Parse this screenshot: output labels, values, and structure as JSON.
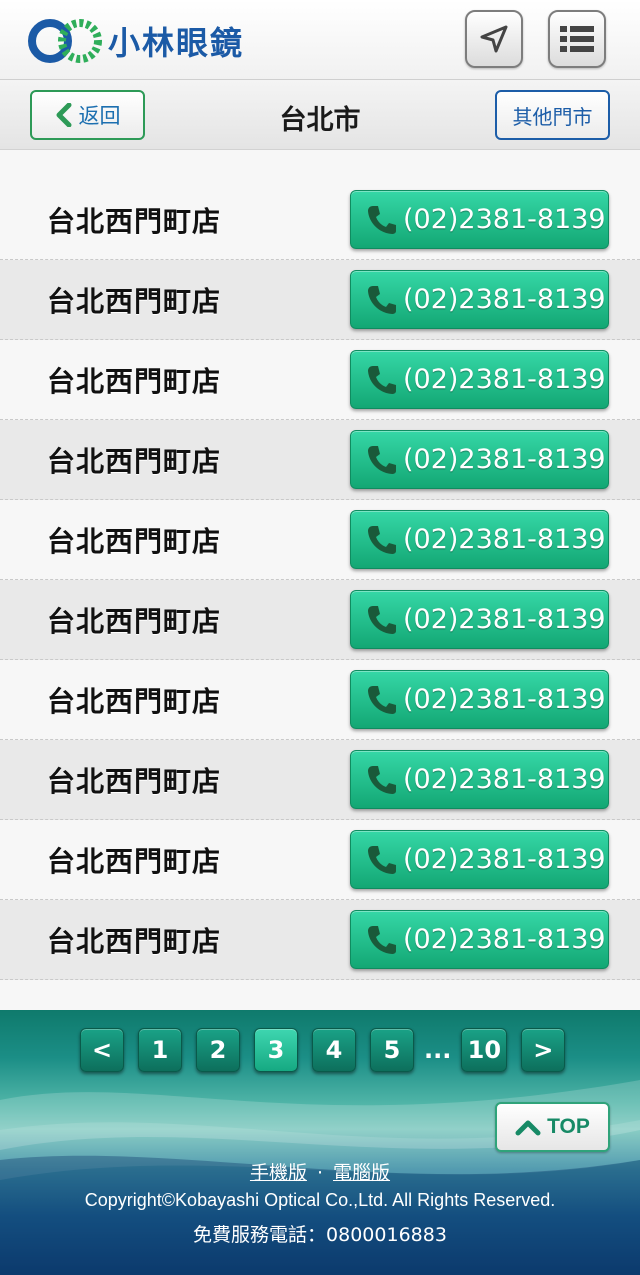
{
  "brand": {
    "name": "小林眼鏡",
    "color": "#1b5aa6"
  },
  "header": {
    "locate_icon": "navigation-arrow-icon",
    "menu_icon": "list-menu-icon"
  },
  "subbar": {
    "back_label": "返回",
    "city": "台北市",
    "other_label": "其他門市"
  },
  "stores": [
    {
      "name": "台北西門町店",
      "phone": "(02)2381-8139"
    },
    {
      "name": "台北西門町店",
      "phone": "(02)2381-8139"
    },
    {
      "name": "台北西門町店",
      "phone": "(02)2381-8139"
    },
    {
      "name": "台北西門町店",
      "phone": "(02)2381-8139"
    },
    {
      "name": "台北西門町店",
      "phone": "(02)2381-8139"
    },
    {
      "name": "台北西門町店",
      "phone": "(02)2381-8139"
    },
    {
      "name": "台北西門町店",
      "phone": "(02)2381-8139"
    },
    {
      "name": "台北西門町店",
      "phone": "(02)2381-8139"
    },
    {
      "name": "台北西門町店",
      "phone": "(02)2381-8139"
    },
    {
      "name": "台北西門町店",
      "phone": "(02)2381-8139"
    }
  ],
  "pager": {
    "prev": "<",
    "pages": [
      "1",
      "2",
      "3",
      "4",
      "5"
    ],
    "ellipsis": "...",
    "last": "10",
    "next": ">",
    "current": "3"
  },
  "footer": {
    "top_label": "TOP",
    "mobile_link": "手機版",
    "separator": "·",
    "desktop_link": "電腦版",
    "copyright": "Copyright©Kobayashi Optical Co.,Ltd. All Rights Reserved.",
    "hotline": "免費服務電話：0800016883"
  },
  "colors": {
    "accent_green": "#13a774",
    "link_blue": "#1c5da8"
  }
}
